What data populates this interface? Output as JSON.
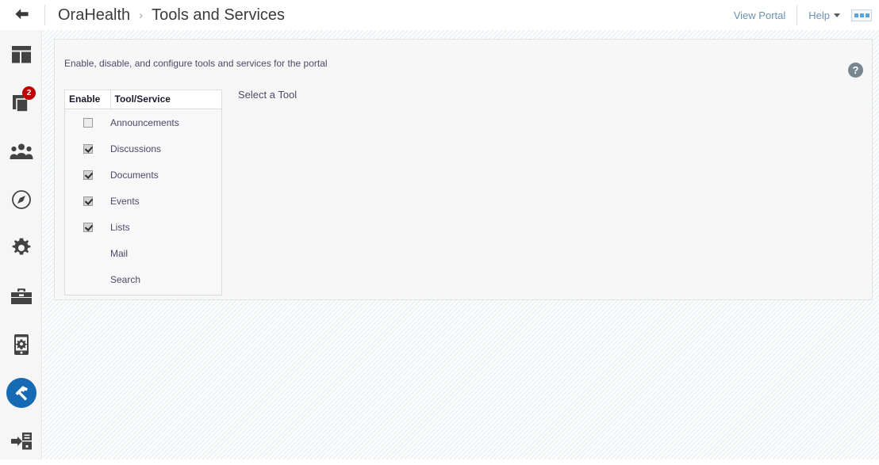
{
  "header": {
    "back_icon": "back-arrow-icon",
    "breadcrumb": {
      "portal": "OraHealth",
      "separator": "›",
      "current": "Tools and Services"
    },
    "view_portal_label": "View Portal",
    "help_label": "Help",
    "panel_toggle_icon": "panel-layout-icon"
  },
  "sidebar": {
    "items": [
      {
        "name": "sidebar-item-overview",
        "icon": "dashboard-layout-icon",
        "badge": "",
        "active": false
      },
      {
        "name": "sidebar-item-assets",
        "icon": "documents-stack-icon",
        "badge": "2",
        "active": false
      },
      {
        "name": "sidebar-item-members",
        "icon": "people-group-icon",
        "badge": "",
        "active": false
      },
      {
        "name": "sidebar-item-discover",
        "icon": "compass-icon",
        "badge": "",
        "active": false
      },
      {
        "name": "sidebar-item-settings",
        "icon": "gear-icon",
        "badge": "",
        "active": false
      },
      {
        "name": "sidebar-item-toolbox",
        "icon": "toolbox-icon",
        "badge": "",
        "active": false
      },
      {
        "name": "sidebar-item-device",
        "icon": "mobile-settings-icon",
        "badge": "",
        "active": false
      },
      {
        "name": "sidebar-item-tools",
        "icon": "hammer-icon",
        "badge": "",
        "active": true
      },
      {
        "name": "sidebar-item-deploy",
        "icon": "server-import-icon",
        "badge": "",
        "active": false
      }
    ]
  },
  "panel": {
    "description": "Enable, disable, and configure tools and services for the portal",
    "help_icon": "question-mark-icon",
    "table": {
      "columns": [
        "Enable",
        "Tool/Service"
      ],
      "rows": [
        {
          "label": "Announcements",
          "has_checkbox": true,
          "checked": false
        },
        {
          "label": "Discussions",
          "has_checkbox": true,
          "checked": true
        },
        {
          "label": "Documents",
          "has_checkbox": true,
          "checked": true
        },
        {
          "label": "Events",
          "has_checkbox": true,
          "checked": true
        },
        {
          "label": "Lists",
          "has_checkbox": true,
          "checked": true
        },
        {
          "label": "Mail",
          "has_checkbox": false,
          "checked": false
        },
        {
          "label": "Search",
          "has_checkbox": false,
          "checked": false
        }
      ]
    },
    "detail_placeholder": "Select a Tool"
  },
  "colors": {
    "accent_blue": "#1669b3",
    "link_blue": "#6a90b4",
    "badge_red": "#c00000",
    "text_dark": "#3b3b3b",
    "text_body": "#4a4a6a"
  }
}
